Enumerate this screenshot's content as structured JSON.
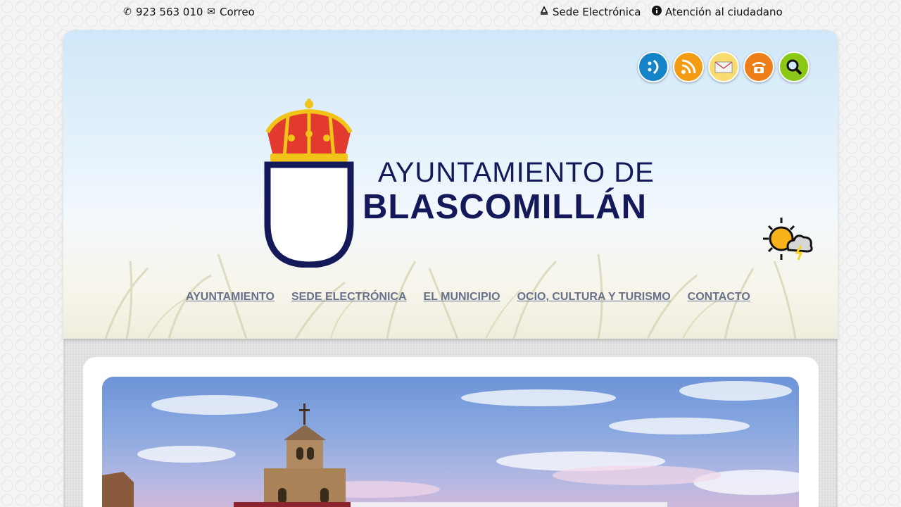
{
  "topbar": {
    "phone": "923 563 010",
    "mail": "Correo",
    "sede": "Sede Electrónica",
    "atencion": "Atención al ciudadano"
  },
  "social": [
    "accessibility-icon",
    "rss-icon",
    "mail-icon",
    "phone-icon",
    "search-icon"
  ],
  "logo": {
    "line1": "AYUNTAMIENTO DE",
    "line2": "BLASCOMILLÁN"
  },
  "nav": {
    "items": [
      {
        "label": "AYUNTAMIENTO"
      },
      {
        "label": "SEDE ELECTRÓNICA"
      },
      {
        "label": "EL MUNICIPIO"
      },
      {
        "label": "OCIO, CULTURA Y TURISMO"
      },
      {
        "label": "CONTACTO"
      }
    ]
  },
  "colors": {
    "brand": "#14195a",
    "nav": "#66708a",
    "crown_red": "#e23a2e",
    "crown_gold": "#f2c318"
  }
}
